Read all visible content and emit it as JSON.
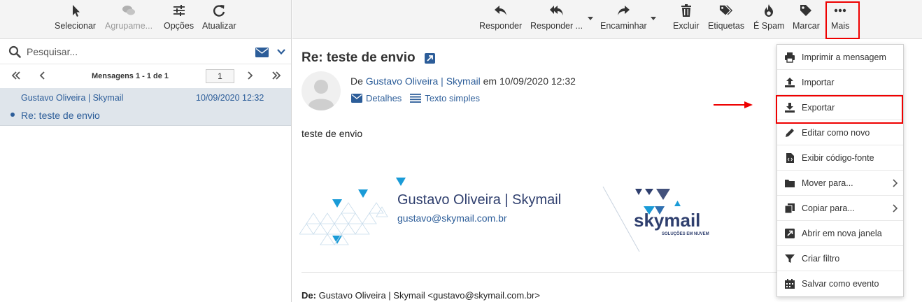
{
  "left_toolbar": {
    "select": "Selecionar",
    "group": "Agrupame...",
    "options": "Opções",
    "refresh": "Atualizar"
  },
  "search": {
    "placeholder": "Pesquisar..."
  },
  "pager": {
    "label": "Mensagens 1 - 1 de 1",
    "page": "1"
  },
  "message_list": [
    {
      "from": "Gustavo Oliveira | Skymail",
      "date": "10/09/2020 12:32",
      "subject": "Re: teste de envio"
    }
  ],
  "right_toolbar": {
    "reply": "Responder",
    "reply_all": "Responder ...",
    "forward": "Encaminhar",
    "delete": "Excluir",
    "tags": "Etiquetas",
    "spam": "É Spam",
    "mark": "Marcar",
    "more": "Mais"
  },
  "message": {
    "subject": "Re: teste de envio",
    "from_prefix": "De",
    "from_name": "Gustavo Oliveira | Skymail",
    "date_prefix": "em",
    "date": "10/09/2020 12:32",
    "details": "Detalhes",
    "plain_text": "Texto simples",
    "body": "teste de envio",
    "signature_name": "Gustavo Oliveira | Skymail",
    "signature_email": "gustavo@skymail.com.br",
    "logo_text": "skymail",
    "logo_tagline": "SOLUÇÕES EM NUVEM",
    "forward_label": "De:",
    "forward_value": "Gustavo Oliveira | Skymail <gustavo@skymail.com.br>"
  },
  "more_menu": [
    {
      "label": "Imprimir a mensagem",
      "icon": "printer-icon"
    },
    {
      "label": "Importar",
      "icon": "upload-icon"
    },
    {
      "label": "Exportar",
      "icon": "download-icon"
    },
    {
      "label": "Editar como novo",
      "icon": "pencil-icon"
    },
    {
      "label": "Exibir código-fonte",
      "icon": "code-file-icon"
    },
    {
      "label": "Mover para...",
      "icon": "folder-icon"
    },
    {
      "label": "Copiar para...",
      "icon": "copy-icon"
    },
    {
      "label": "Abrir em nova janela",
      "icon": "external-window-icon"
    },
    {
      "label": "Criar filtro",
      "icon": "filter-icon"
    },
    {
      "label": "Salvar como evento",
      "icon": "calendar-icon"
    }
  ],
  "colors": {
    "link": "#2c5d99",
    "highlight": "#e00000",
    "selected_row": "#dfe5eb"
  }
}
